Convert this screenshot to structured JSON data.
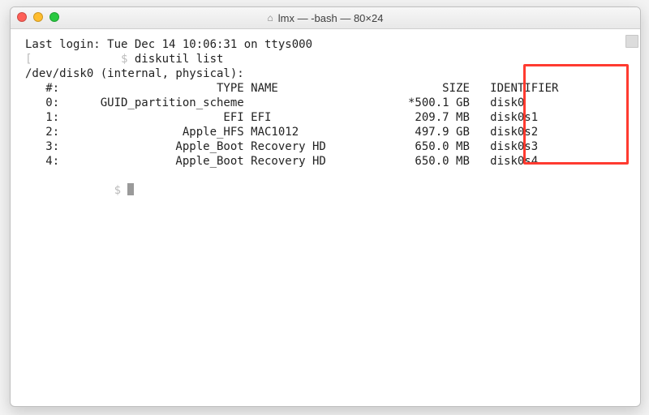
{
  "title": "lmx — -bash — 80×24",
  "last_login": "Last login: Tue Dec 14 10:06:31 on ttys000",
  "prompt1": "[             $ ",
  "command": "diskutil list",
  "device_line": "/dev/disk0 (internal, physical):",
  "header": {
    "num": "#:",
    "type": "TYPE",
    "name": "NAME",
    "size": "SIZE",
    "ident": "IDENTIFIER"
  },
  "rows": [
    {
      "num": "0:",
      "type": "GUID_partition_scheme",
      "name": "",
      "size": "*500.1 GB",
      "ident": "disk0"
    },
    {
      "num": "1:",
      "type": "EFI",
      "name": "EFI",
      "size": "209.7 MB",
      "ident": "disk0s1"
    },
    {
      "num": "2:",
      "type": "Apple_HFS",
      "name": "MAC1012",
      "size": "497.9 GB",
      "ident": "disk0s2"
    },
    {
      "num": "3:",
      "type": "Apple_Boot",
      "name": "Recovery HD",
      "size": "650.0 MB",
      "ident": "disk0s3"
    },
    {
      "num": "4:",
      "type": "Apple_Boot",
      "name": "Recovery HD",
      "size": "650.0 MB",
      "ident": "disk0s4"
    }
  ],
  "prompt2": "             $ "
}
